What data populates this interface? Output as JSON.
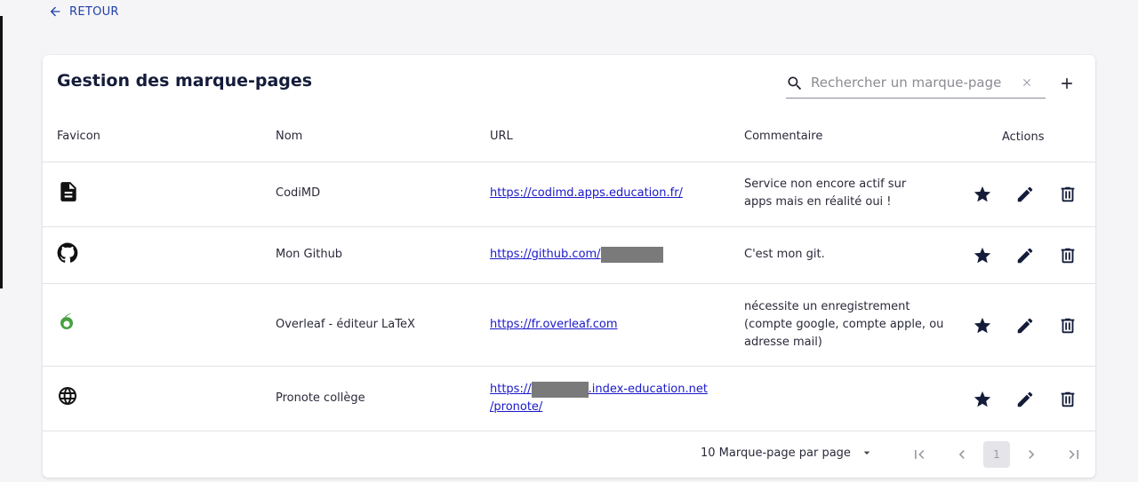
{
  "nav": {
    "back_label": "RETOUR"
  },
  "card": {
    "title": "Gestion des marque-pages",
    "search_placeholder": "Rechercher un marque-page"
  },
  "columns": [
    "Favicon",
    "Nom",
    "URL",
    "Commentaire",
    "Actions"
  ],
  "rows": [
    {
      "favicon": "document-icon",
      "name": "CodiMD",
      "url_lines": [
        "https://codimd.apps.education.fr/"
      ],
      "comment": "Service non encore actif sur apps mais en réalité oui !"
    },
    {
      "favicon": "github-icon",
      "name": "Mon Github",
      "url_lines": [
        "https://github.com/"
      ],
      "comment": "C'est mon git."
    },
    {
      "favicon": "overleaf-icon",
      "name": "Overleaf - éditeur LaTeX",
      "url_lines": [
        "https://fr.overleaf.com"
      ],
      "comment": "nécessite un enregistrement (compte google, compte apple, ou adresse mail)"
    },
    {
      "favicon": "globe-icon",
      "name": "Pronote collège",
      "url_lines": [
        "https://",
        ".index-education.net",
        "/pronote/"
      ],
      "comment": ""
    }
  ],
  "row_actions": [
    "star-icon",
    "edit-icon",
    "delete-icon"
  ],
  "pagination": {
    "per_page_label": "10 Marque-page par page",
    "current_page": "1"
  },
  "colors": {
    "accent": "#1f3ea8",
    "title": "#141c3a",
    "link": "#1a18c9",
    "overleaf_green": "#47a141",
    "redaction": "#7a7a7a"
  }
}
